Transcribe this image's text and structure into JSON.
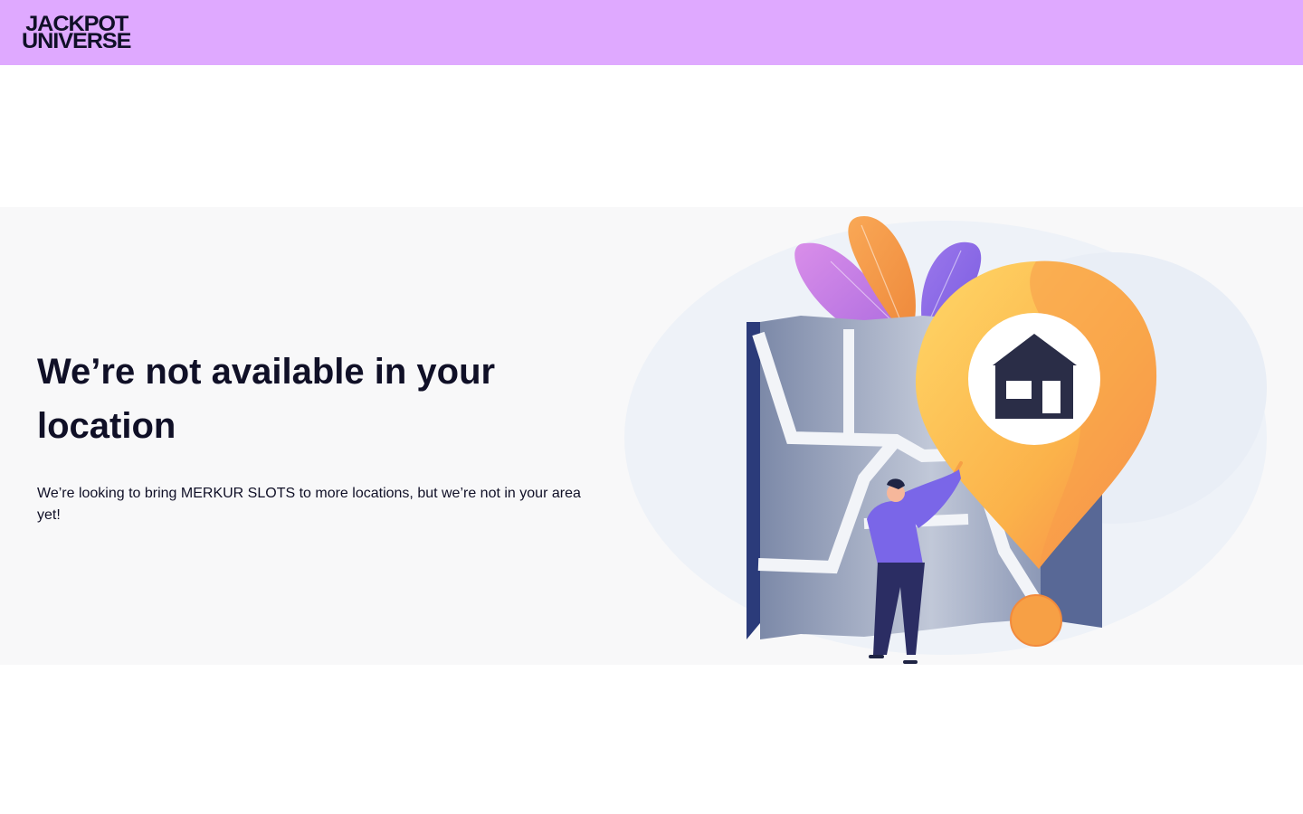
{
  "header": {
    "logo_line1": "JACKPOT",
    "logo_line2": "UNIVERSE",
    "background": "#dfa9ff"
  },
  "main": {
    "title": "We’re not available in your location",
    "description": "We’re looking to bring MERKUR SLOTS to more locations, but we’re not in your area yet!"
  },
  "illustration": {
    "icon": "location-pin-house-icon",
    "pin_color": "#fbb24a",
    "map_color": "#8e9ab8"
  }
}
